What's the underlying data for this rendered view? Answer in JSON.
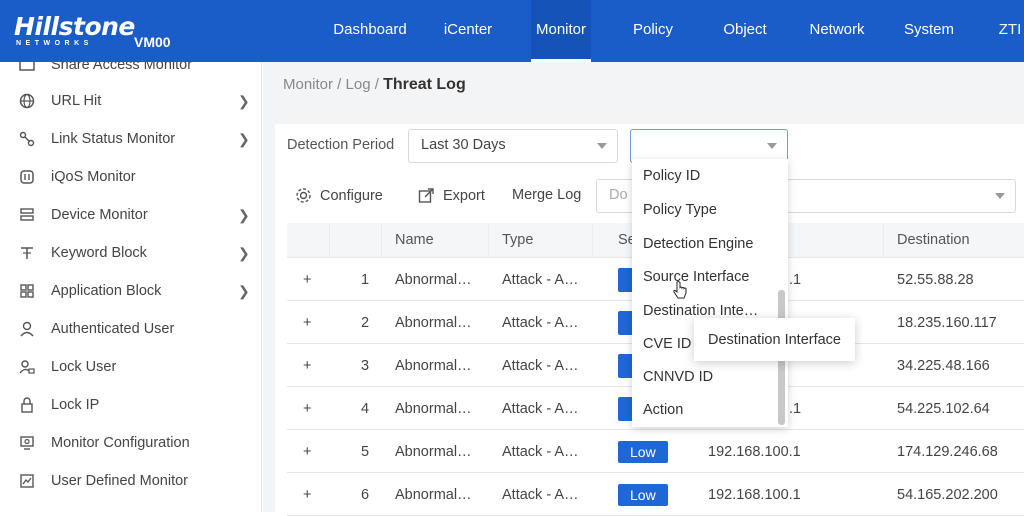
{
  "brand": {
    "logo": "Hillstone",
    "logo_sub": "NETWORKS",
    "device": "VM00"
  },
  "nav": [
    "Dashboard",
    "iCenter",
    "Monitor",
    "Policy",
    "Object",
    "Network",
    "System",
    "ZTI"
  ],
  "nav_active": "Monitor",
  "sidebar": {
    "items": [
      {
        "label": "Share Access Monitor",
        "icon": "share-access-icon",
        "arrow": false
      },
      {
        "label": "URL Hit",
        "icon": "globe-icon",
        "arrow": true
      },
      {
        "label": "Link Status Monitor",
        "icon": "link-status-icon",
        "arrow": true
      },
      {
        "label": "iQoS Monitor",
        "icon": "iqos-icon",
        "arrow": false
      },
      {
        "label": "Device Monitor",
        "icon": "device-icon",
        "arrow": true
      },
      {
        "label": "Keyword Block",
        "icon": "keyword-icon",
        "arrow": true
      },
      {
        "label": "Application Block",
        "icon": "application-icon",
        "arrow": true
      },
      {
        "label": "Authenticated User",
        "icon": "user-icon",
        "arrow": false
      },
      {
        "label": "Lock User",
        "icon": "lock-user-icon",
        "arrow": false
      },
      {
        "label": "Lock IP",
        "icon": "lock-icon",
        "arrow": false
      },
      {
        "label": "Monitor Configuration",
        "icon": "monitor-config-icon",
        "arrow": false
      },
      {
        "label": "User Defined Monitor",
        "icon": "user-defined-icon",
        "arrow": false
      }
    ]
  },
  "breadcrumb": {
    "path": "Monitor / Log / ",
    "current": "Threat Log"
  },
  "filters": {
    "period_label": "Detection Period",
    "period_value": "Last 30 Days",
    "field_value": "",
    "search_placeholder": "Do"
  },
  "toolbar": {
    "configure": "Configure",
    "export": "Export",
    "merge": "Merge Log"
  },
  "table": {
    "headers": [
      "",
      "",
      "Name",
      "Type",
      "Se",
      "",
      "Destination"
    ],
    "rows": [
      {
        "num": "1",
        "name": "Abnormal…",
        "type": "Attack - A…",
        "sev": "",
        "src": ".1",
        "dst": "52.55.88.28"
      },
      {
        "num": "2",
        "name": "Abnormal…",
        "type": "Attack - A…",
        "sev": "",
        "src": "",
        "dst": "18.235.160.117"
      },
      {
        "num": "3",
        "name": "Abnormal…",
        "type": "Attack - A…",
        "sev": "",
        "src": "",
        "dst": "34.225.48.166"
      },
      {
        "num": "4",
        "name": "Abnormal…",
        "type": "Attack - A…",
        "sev": "",
        "src": ".1",
        "dst": "54.225.102.64"
      },
      {
        "num": "5",
        "name": "Abnormal…",
        "type": "Attack - A…",
        "sev": "Low",
        "src": "192.168.100.1",
        "dst": "174.129.246.68"
      },
      {
        "num": "6",
        "name": "Abnormal…",
        "type": "Attack - A…",
        "sev": "Low",
        "src": "192.168.100.1",
        "dst": "54.165.202.200"
      }
    ],
    "expand_symbol": "+"
  },
  "dropdown": {
    "items": [
      "Policy ID",
      "Policy Type",
      "Detection Engine",
      "Source Interface",
      "Destination Inte…",
      "CVE ID",
      "CNNVD ID",
      "Action"
    ],
    "hovered": "Source Interface"
  },
  "tooltip": "Destination Interface",
  "colors": {
    "topbar": "#1a5cc8",
    "badge": "#1e67d6"
  }
}
